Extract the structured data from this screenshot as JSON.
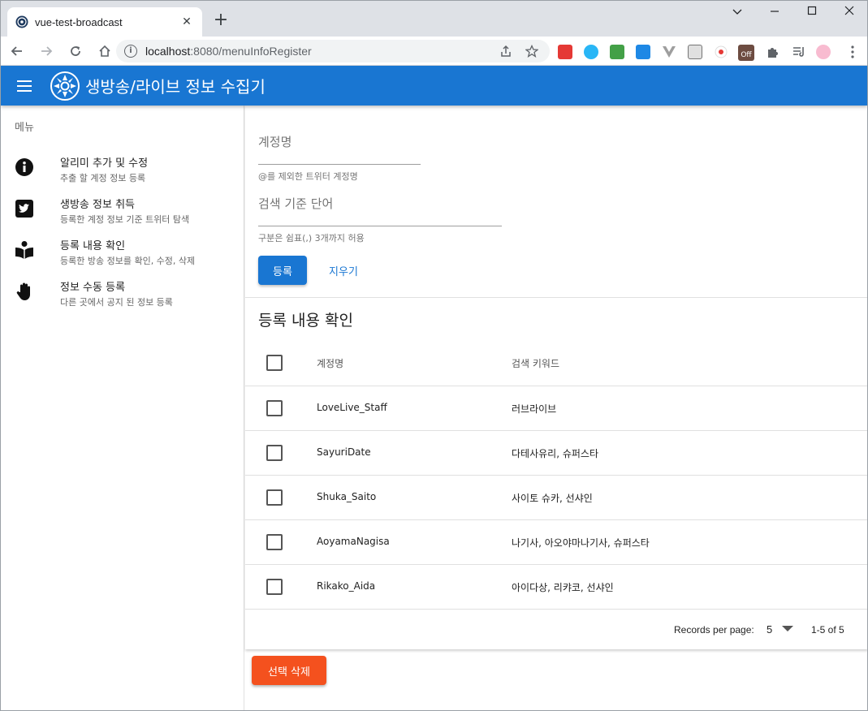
{
  "browser": {
    "tab_title": "vue-test-broadcast",
    "tab_close": "✕",
    "new_tab": "+",
    "url_host": "localhost",
    "url_rest": ":8080/menuInfoRegister",
    "extension_badge": "Off"
  },
  "appbar": {
    "title": "생방송/라이브 정보 수집기"
  },
  "sidebar": {
    "header": "메뉴",
    "items": [
      {
        "title": "알리미 추가 및 수정",
        "subtitle": "추출 할 계정 정보 등록",
        "icon": "info-icon"
      },
      {
        "title": "생방송 정보 취득",
        "subtitle": "등록한 계정 정보 기준 트위터 탐색",
        "icon": "twitter-icon"
      },
      {
        "title": "등록 내용 확인",
        "subtitle": "등록한 방송 정보를 확인, 수정, 삭제",
        "icon": "book-reader-icon"
      },
      {
        "title": "정보 수동 등록",
        "subtitle": "다른 곳에서 공지 된 정보 등록",
        "icon": "hand-icon"
      }
    ]
  },
  "form": {
    "account_label": "계정명",
    "account_hint": "@를 제외한 트위터 계정명",
    "account_value": "",
    "keyword_label": "검색 기준 단어",
    "keyword_hint": "구분은 쉼표(,) 3개까지 허용",
    "keyword_value": "",
    "register_button": "등록",
    "clear_button": "지우기"
  },
  "table": {
    "title": "등록 내용 확인",
    "headers": {
      "account": "계정명",
      "keywords": "검색 키워드"
    },
    "rows": [
      {
        "account": "LoveLive_Staff",
        "keywords": "러브라이브"
      },
      {
        "account": "SayuriDate",
        "keywords": "다테사유리, 슈퍼스타"
      },
      {
        "account": "Shuka_Saito",
        "keywords": "사이토 슈카, 선샤인"
      },
      {
        "account": "AoyamaNagisa",
        "keywords": "나기사, 아오야마나기사, 슈퍼스타"
      },
      {
        "account": "Rikako_Aida",
        "keywords": "아이다상, 리캬코, 선샤인"
      }
    ],
    "records_per_page_label": "Records per page:",
    "records_per_page_value": "5",
    "page_range": "1-5 of 5"
  },
  "actions": {
    "delete_selected": "선택 삭제"
  },
  "colors": {
    "primary": "#1976d2",
    "danger": "#f4511e"
  }
}
